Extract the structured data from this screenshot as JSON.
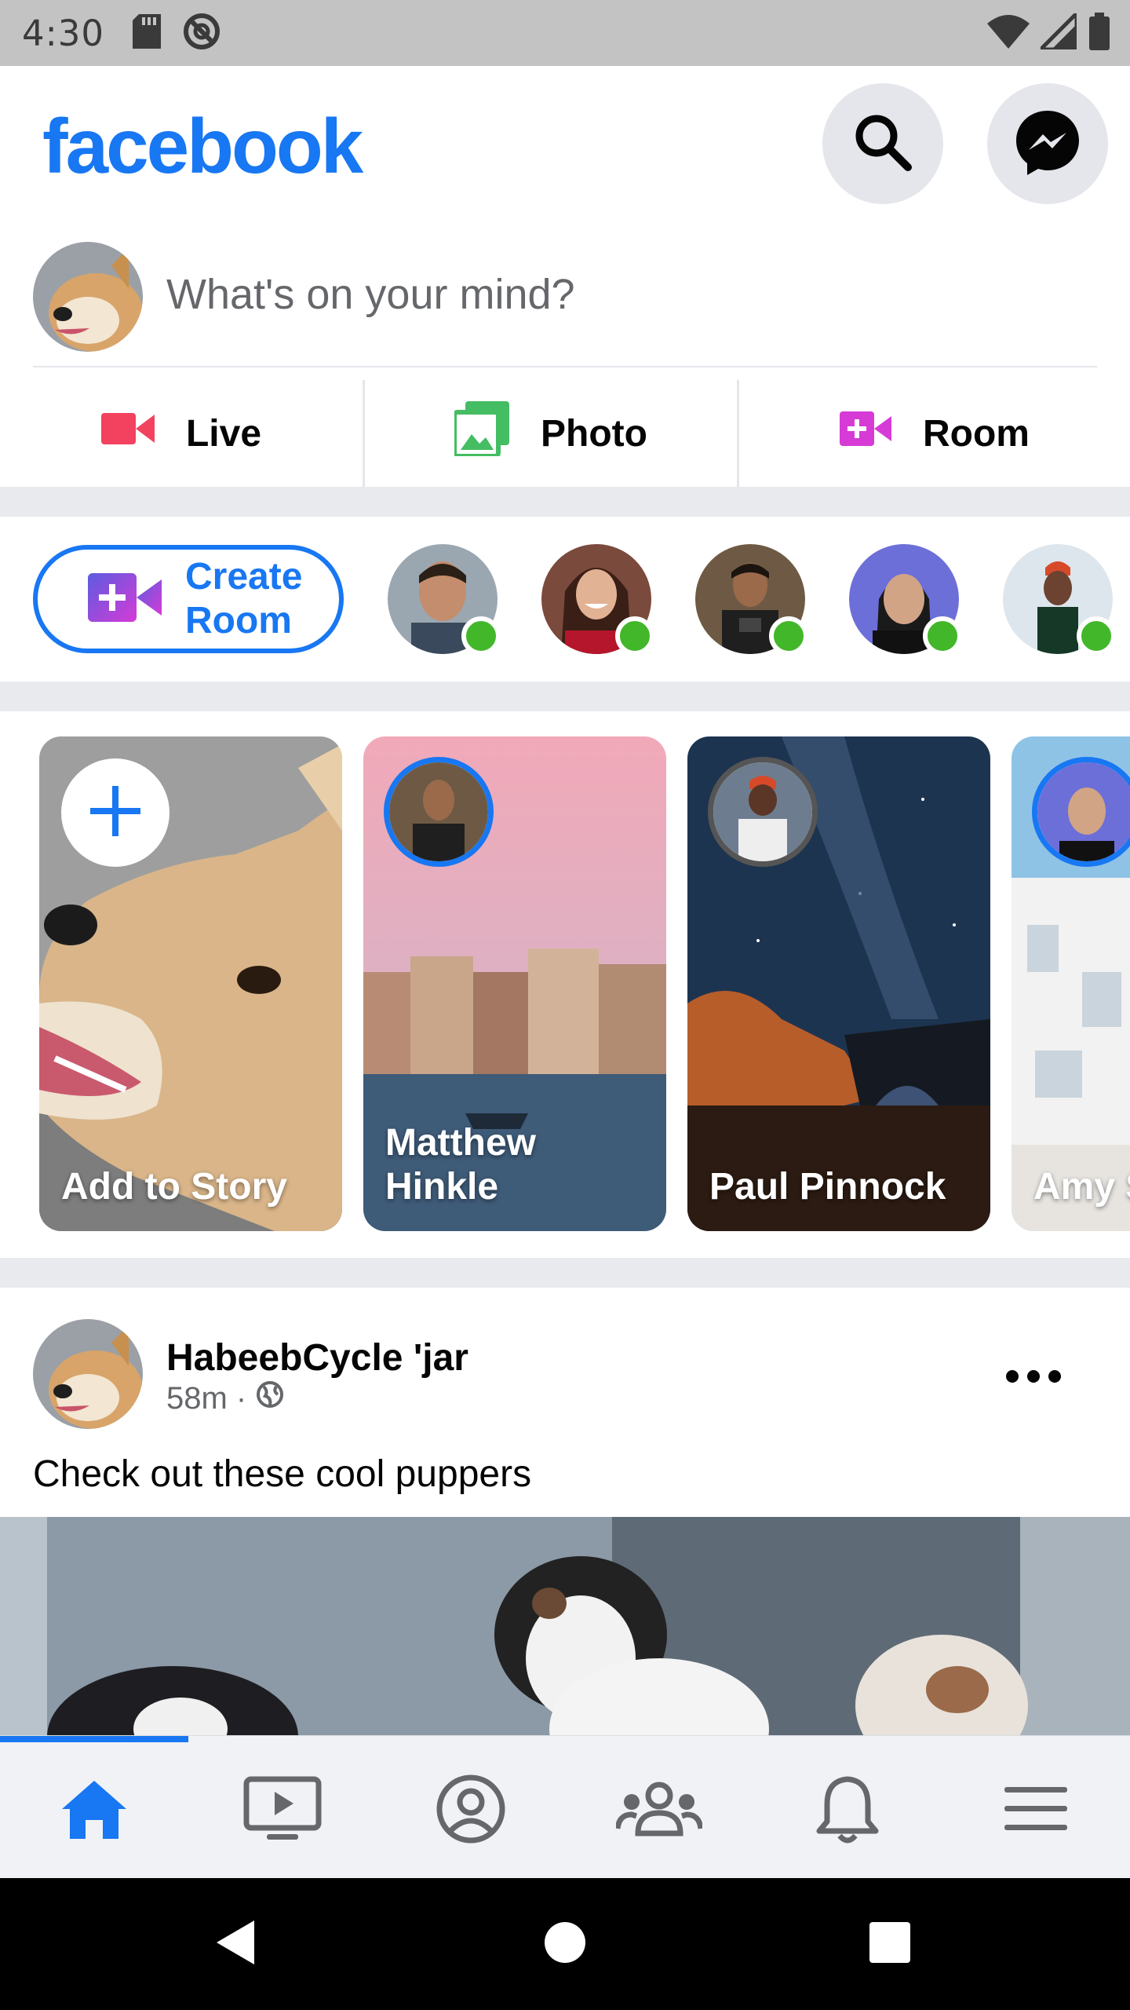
{
  "status_bar": {
    "time": "4:30"
  },
  "header": {
    "logo": "facebook",
    "search_icon": "search-icon",
    "messenger_icon": "messenger-icon"
  },
  "composer": {
    "placeholder": "What's on your mind?",
    "actions": [
      {
        "label": "Live",
        "icon": "live-video-icon",
        "color": "#f3425f"
      },
      {
        "label": "Photo",
        "icon": "photo-icon",
        "color": "#45bd62"
      },
      {
        "label": "Room",
        "icon": "room-icon",
        "color": "#d63bd6"
      }
    ]
  },
  "rooms": {
    "create_label": "Create Room",
    "online_color": "#42b72a"
  },
  "stories": [
    {
      "name": "Add to Story"
    },
    {
      "name": "Matthew Hinkle"
    },
    {
      "name": "Paul Pinnock"
    },
    {
      "name": "Amy S"
    }
  ],
  "post": {
    "author": "HabeebCycle 'jar",
    "time": "58m ·",
    "text": "Check out these cool puppers"
  },
  "bottom_nav": {
    "active_color": "#1877f2",
    "tabs": [
      "home-icon",
      "watch-icon",
      "profile-icon",
      "groups-icon",
      "notifications-icon",
      "menu-icon"
    ]
  },
  "colors": {
    "brand": "#1877f2",
    "separator": "#e8eaee"
  }
}
